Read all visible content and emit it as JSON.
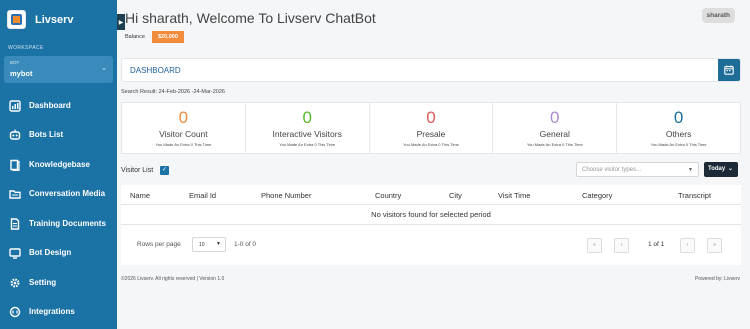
{
  "brand": {
    "name": "Livserv"
  },
  "sidebar": {
    "workspace_label": "WORKSPACE",
    "bot_label": "BOT",
    "bot_name": "mybot",
    "items": [
      {
        "label": "Dashboard",
        "icon": "dashboard-icon"
      },
      {
        "label": "Bots List",
        "icon": "robot-icon"
      },
      {
        "label": "Knowledgebase",
        "icon": "book-icon"
      },
      {
        "label": "Conversation Media",
        "icon": "folder-icon"
      },
      {
        "label": "Training Documents",
        "icon": "document-icon"
      },
      {
        "label": "Bot Design",
        "icon": "design-icon"
      },
      {
        "label": "Setting",
        "icon": "gear-icon"
      },
      {
        "label": "Integrations",
        "icon": "integration-icon"
      }
    ]
  },
  "header": {
    "welcome": "Hi sharath, Welcome To Livserv ChatBot",
    "user": "sharath",
    "balance_label": "Balance",
    "balance_value": "$20,000"
  },
  "dashboard": {
    "title": "DASHBOARD",
    "search_result": "Search Result: 24-Feb-2026 -24-Mar-2026"
  },
  "stats": [
    {
      "value": "0",
      "label": "Visitor Count",
      "sub": "You Made An Extra 0 This Time",
      "color": "#f08c3c"
    },
    {
      "value": "0",
      "label": "Interactive Visitors",
      "sub": "You Made An Extra 0 This Time",
      "color": "#5cb82e"
    },
    {
      "value": "0",
      "label": "Presale",
      "sub": "You Made An Extra 0 This Time",
      "color": "#e35a5a"
    },
    {
      "value": "0",
      "label": "General",
      "sub": "You Made An Extra 0 This Time",
      "color": "#a98cd0"
    },
    {
      "value": "0",
      "label": "Others",
      "sub": "You Made An Extra 0 This Time",
      "color": "#1d6d98"
    }
  ],
  "visitors": {
    "list_label": "Visitor List",
    "filter_placeholder": "Choose visitor types...",
    "range_button": "Today",
    "columns": [
      "Name",
      "Email Id",
      "Phone Number",
      "Country",
      "City",
      "Visit Time",
      "Category",
      "Transcript"
    ],
    "empty_message": "No visitors found for selected period",
    "rows_per_page_label": "Rows per page",
    "rows_per_page_value": "10",
    "range_text": "1-0 of 0",
    "page_info": "1 of 1"
  },
  "footer": {
    "copyright": "©2026 Livserv. All rights reserved | Version 1.0",
    "powered": "Powered by: Livserv"
  }
}
